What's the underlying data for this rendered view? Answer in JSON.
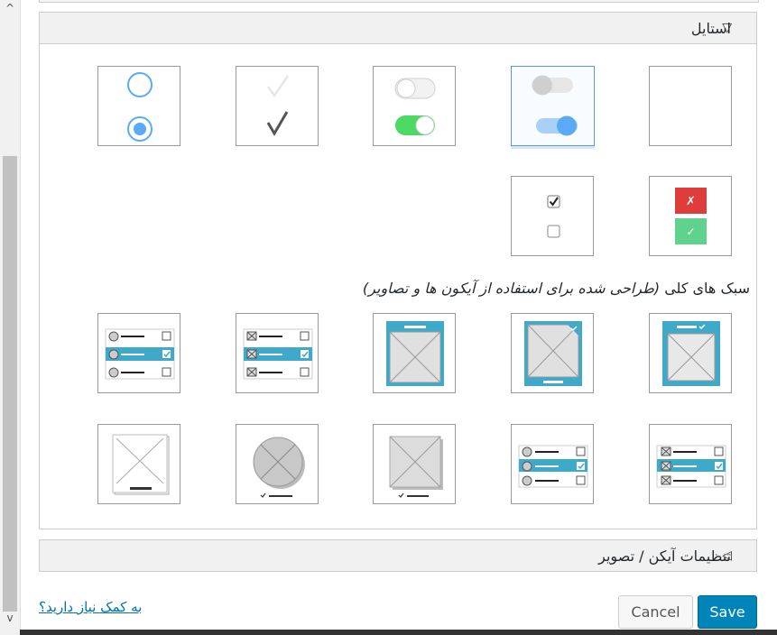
{
  "style_panel": {
    "title": "استایل",
    "toggle_icon": "▽"
  },
  "general_styles": {
    "title": "سبک های کلی",
    "subtitle": "(طراحی شده برای استفاده از آیکون ها و تصاویر)"
  },
  "icon_panel": {
    "title": "تنظیمات آیکن / تصویر",
    "toggle_icon": "◁"
  },
  "footer": {
    "help_link": "به کمک نیاز دارید؟",
    "cancel_label": "Cancel",
    "save_label": "Save"
  },
  "scrollbar": {
    "up_arrow": "^",
    "down_arrow": "v"
  },
  "colors": {
    "accent": "#3fa9c9",
    "toggle_blue": "#5aaaf5",
    "toggle_green": "#4cd964",
    "error_red": "#e03c3c",
    "success_green": "#5fd38d",
    "save_button": "#0085ba"
  }
}
